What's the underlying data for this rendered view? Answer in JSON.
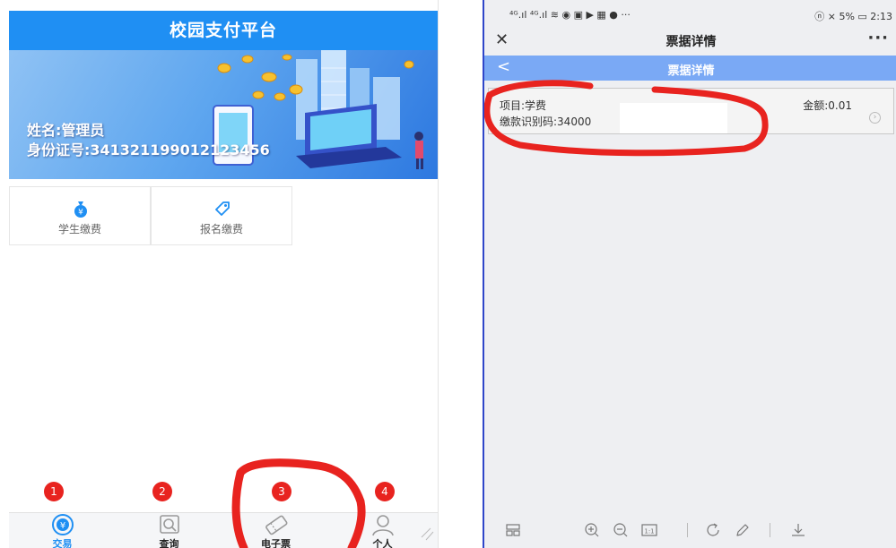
{
  "left": {
    "header_title": "校园支付平台",
    "banner": {
      "name": "姓名:管理员",
      "id_number": "身份证号:341321199012123456"
    },
    "tiles": [
      {
        "label": "学生缴费",
        "icon": "money-bag-icon"
      },
      {
        "label": "报名缴费",
        "icon": "tag-icon"
      }
    ],
    "tabs": [
      {
        "label": "交易",
        "icon": "yuan-coin-icon",
        "badge": "1",
        "active": true
      },
      {
        "label": "查询",
        "icon": "search-icon",
        "badge": "2",
        "active": false
      },
      {
        "label": "电子票",
        "icon": "ticket-icon",
        "badge": "3",
        "active": false
      },
      {
        "label": "个人",
        "icon": "user-icon",
        "badge": "4",
        "active": false
      }
    ],
    "colors": {
      "primary": "#1f8ff3",
      "badge": "#e8231f",
      "annotation": "#e8231f"
    }
  },
  "right": {
    "status": {
      "left": "⁴ᴳ.ıl ⁴ᴳ.ıl ≋ ◉ ▣ ▶ ▦ ● ···",
      "right": "ⓝ ⨯ 5% ▭ 2:13"
    },
    "nav": {
      "close": "✕",
      "title": "票据详情",
      "more": "···"
    },
    "page": {
      "back": "<",
      "title": "票据详情"
    },
    "card": {
      "item": "项目:学费",
      "amount": "金额:0.01",
      "code": "缴款识别码:34000"
    },
    "toolbar": [
      "grid-icon",
      "zoom-in-icon",
      "zoom-out-icon",
      "actual-size-icon",
      "rotate-icon",
      "edit-icon",
      "download-icon"
    ],
    "colors": {
      "page_header": "#7aa9f5",
      "divider": "#2f46c9"
    }
  }
}
